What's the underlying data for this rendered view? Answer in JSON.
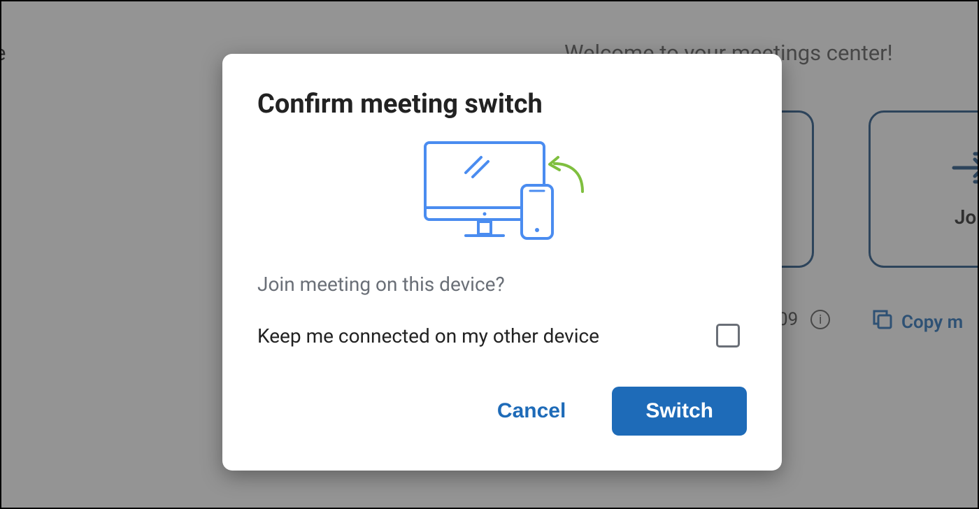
{
  "background": {
    "side_letter": "e",
    "welcome": "Welcome to your meetings center!",
    "join_card_label": "Join",
    "number_fragment": "09",
    "copy_label": "Copy m"
  },
  "modal": {
    "title": "Confirm meeting switch",
    "question": "Join meeting on this device?",
    "checkbox_label": "Keep me connected on my other device",
    "checkbox_checked": false,
    "actions": {
      "cancel": "Cancel",
      "switch": "Switch"
    }
  },
  "colors": {
    "accent": "#1e6bb8",
    "outline": "#1b4f82",
    "illustration_blue": "#4a8cf0",
    "illustration_green": "#7fbf3f",
    "text_muted": "#6a6f77"
  }
}
